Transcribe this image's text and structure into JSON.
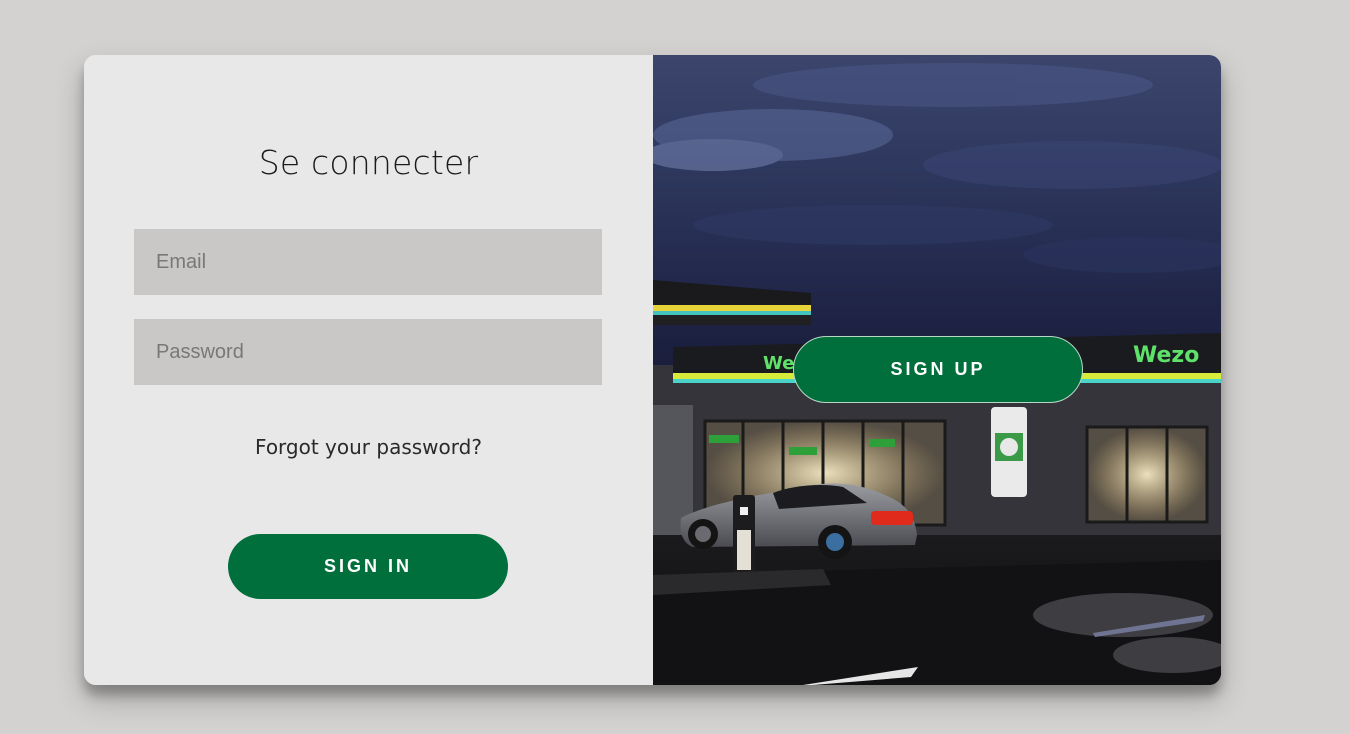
{
  "login": {
    "title": "Se connecter",
    "email_placeholder": "Email",
    "password_placeholder": "Password",
    "forgot_label": "Forgot your password?",
    "signin_label": "SIGN IN"
  },
  "overlay": {
    "signup_label": "SIGN UP",
    "brand_sign_text": "Wezo"
  },
  "colors": {
    "accent": "#006f3b",
    "page_background": "#d4d2d0",
    "panel_background": "#e8e8e8",
    "input_background": "#cac8c6"
  }
}
